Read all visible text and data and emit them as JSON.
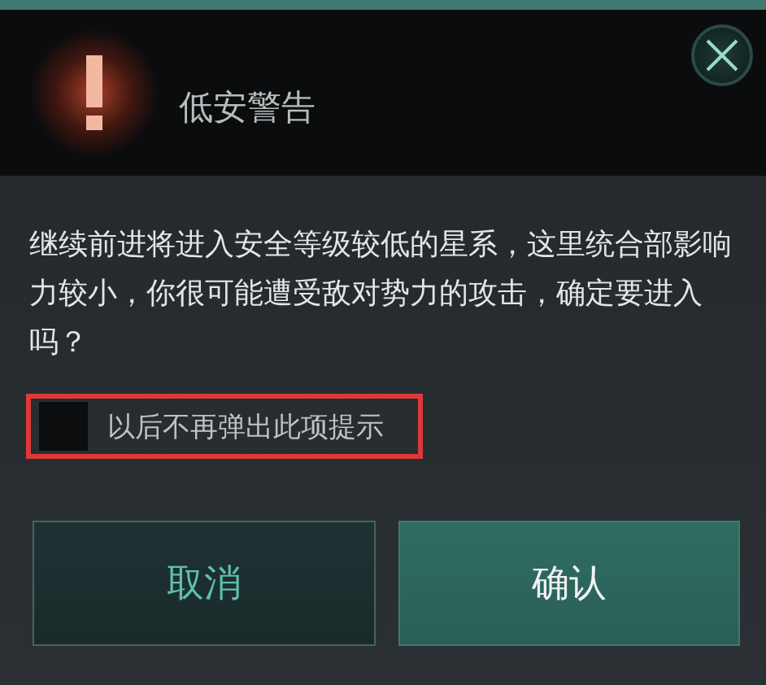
{
  "dialog": {
    "title": "低安警告",
    "message": "继续前进将进入安全等级较低的星系，这里统合部影响力较小，你很可能遭受敌对势力的攻击，确定要进入吗？"
  },
  "option": {
    "label": "以后不再弹出此项提示",
    "checked": false,
    "highlighted": true
  },
  "buttons": [
    {
      "label": "取消",
      "kind": "secondary"
    },
    {
      "label": "确认",
      "kind": "primary"
    }
  ]
}
